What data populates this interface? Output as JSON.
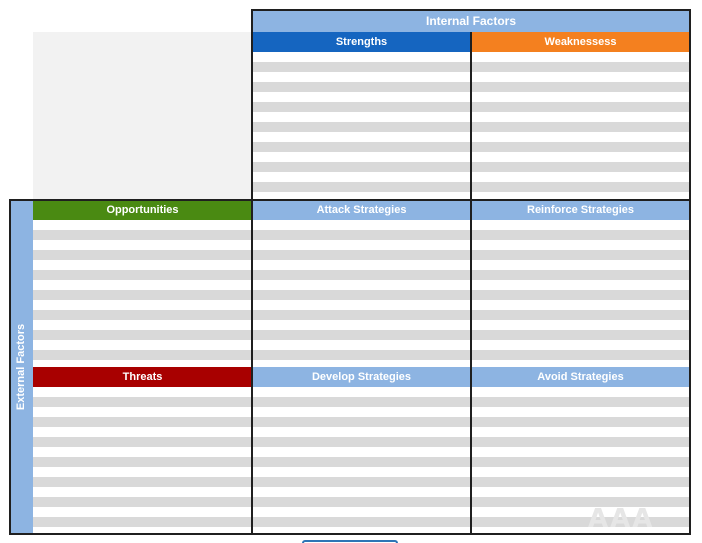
{
  "colors": {
    "light_blue": "#8db4e2",
    "strengths_blue": "#1565c0",
    "weaknesses_orange": "#f4801f",
    "opportunities_green": "#4a8a12",
    "threats_red": "#a80000",
    "stripe_gray": "#d9d9d9",
    "border": "#1f1f1f"
  },
  "internal": {
    "title": "Internal Factors",
    "strengths": "Strengths",
    "weaknesses": "Weaknessess"
  },
  "external": {
    "title": "External Factors",
    "opportunities": "Opportunities",
    "threats": "Threats"
  },
  "strategies": {
    "attack": "Attack Strategies",
    "reinforce": "Reinforce Strategies",
    "develop": "Develop Strategies",
    "avoid": "Avoid Strategies"
  },
  "watermark": "AAA"
}
